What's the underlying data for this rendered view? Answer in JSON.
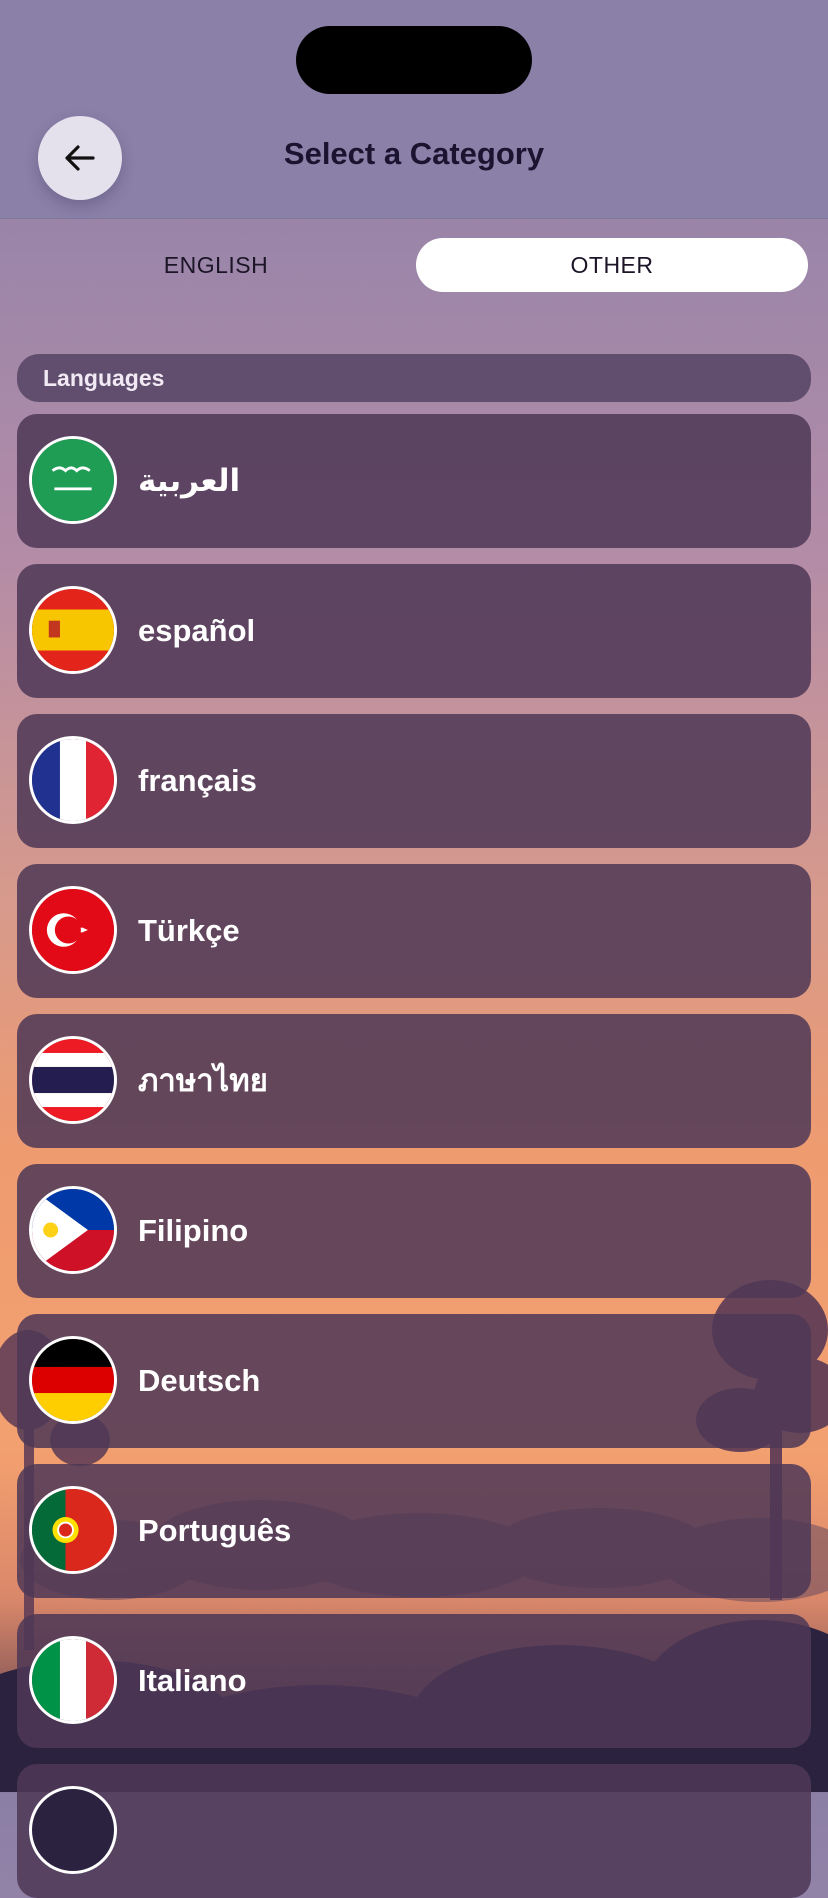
{
  "header": {
    "title": "Select a Category"
  },
  "tabs": [
    {
      "label": "ENGLISH",
      "selected": false
    },
    {
      "label": "OTHER",
      "selected": true
    }
  ],
  "section": {
    "title": "Languages"
  },
  "languages": [
    {
      "label": "العربية",
      "flag": "saudi-arabia-flag-icon"
    },
    {
      "label": "español",
      "flag": "spain-flag-icon"
    },
    {
      "label": "français",
      "flag": "france-flag-icon"
    },
    {
      "label": "Türkçe",
      "flag": "turkey-flag-icon"
    },
    {
      "label": "ภาษาไทย",
      "flag": "thailand-flag-icon"
    },
    {
      "label": "Filipino",
      "flag": "philippines-flag-icon"
    },
    {
      "label": "Deutsch",
      "flag": "germany-flag-icon"
    },
    {
      "label": "Português",
      "flag": "portugal-flag-icon"
    },
    {
      "label": "Italiano",
      "flag": "italy-flag-icon"
    }
  ],
  "colors": {
    "header_bg": "#8a80a8",
    "row_bg": "#4e3856",
    "selected_tab_bg": "#ffffff"
  }
}
